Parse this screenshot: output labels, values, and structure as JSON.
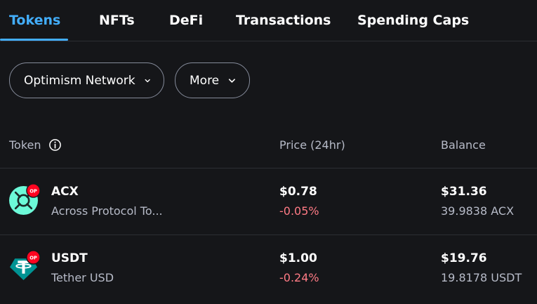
{
  "tabs": [
    {
      "label": "Tokens",
      "active": true
    },
    {
      "label": "NFTs",
      "active": false
    },
    {
      "label": "DeFi",
      "active": false
    },
    {
      "label": "Transactions",
      "active": false
    },
    {
      "label": "Spending Caps",
      "active": false
    }
  ],
  "filters": {
    "network_label": "Optimism Network",
    "more_label": "More"
  },
  "columns": {
    "token": "Token",
    "price": "Price (24hr)",
    "balance": "Balance"
  },
  "tokens": [
    {
      "symbol": "ACX",
      "name": "Across Protocol To...",
      "network_badge": "OP",
      "price": "$0.78",
      "change": "-0.05%",
      "balance_fiat": "$31.36",
      "balance_amount": "39.9838 ACX",
      "icon": "acx-token-icon"
    },
    {
      "symbol": "USDT",
      "name": "Tether USD",
      "network_badge": "OP",
      "price": "$1.00",
      "change": "-0.24%",
      "balance_fiat": "$19.76",
      "balance_amount": "19.8178 USDT",
      "icon": "usdt-token-icon"
    }
  ],
  "colors": {
    "background": "#151619",
    "accent": "#43aefc",
    "negative": "#ff7b85",
    "muted_text": "#b7bbc8",
    "op_badge": "#ff0420",
    "acx_green": "#6cf9d8",
    "usdt_green": "#009393"
  }
}
